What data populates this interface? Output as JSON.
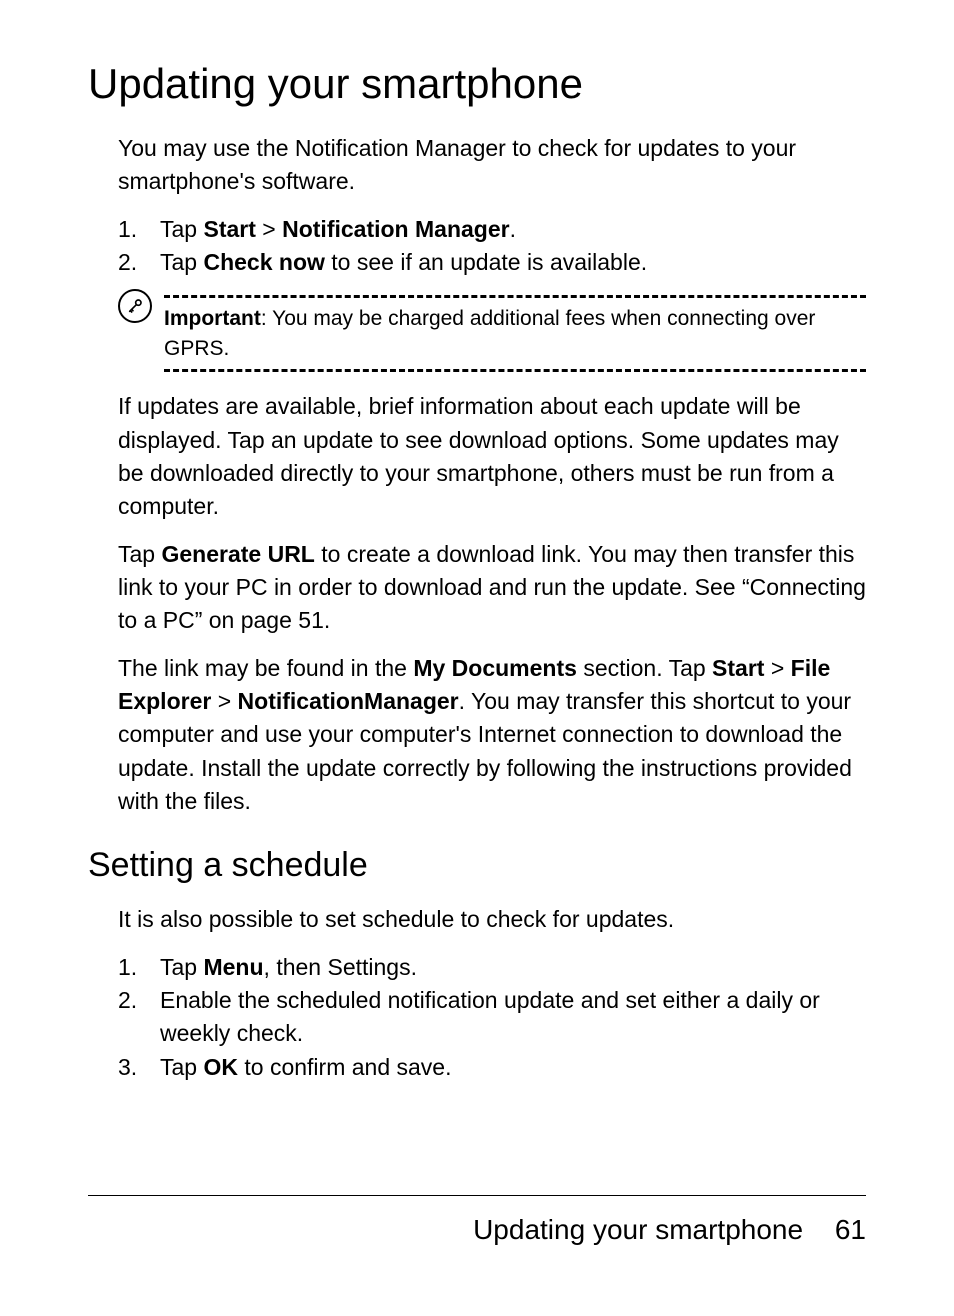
{
  "heading": "Updating your smartphone",
  "intro": "You may use the Notification Manager to check for updates to your smartphone's software.",
  "steps1": {
    "s1a": "Tap ",
    "s1b": "Start",
    "s1c": " > ",
    "s1d": "Notification Manager",
    "s1e": ".",
    "s2a": "Tap ",
    "s2b": "Check now",
    "s2c": " to see if an update is available."
  },
  "note": {
    "label": "Important",
    "text": ": You may be charged additional fees when connecting over GPRS."
  },
  "para2": "If updates are available, brief information about each update will be displayed. Tap an update to see download options. Some updates may be downloaded directly to your smart­phone, others must be run from a computer.",
  "para3": {
    "a": "Tap ",
    "b": "Generate URL",
    "c": " to create a download link. You may then transfer this link to your PC in order to download and run the update. See “Connecting to a PC” on page 51."
  },
  "para4": {
    "a": "The link may be found in the ",
    "b": "My Documents",
    "c": " section. Tap ",
    "d": "Start",
    "e": " > ",
    "f": "File Explorer",
    "g": " > ",
    "h": "NotificationManager",
    "i": ". You may transfer this shortcut to your computer and use your computer's Internet connection to download the update. Install the update cor­rectly by following the instructions provided with the files."
  },
  "subheading": "Setting a schedule",
  "para5": "It is also possible to set schedule to check for updates.",
  "steps2": {
    "s1a": "Tap ",
    "s1b": "Menu",
    "s1c": ", then Settings.",
    "s2": "Enable the scheduled notification update and set either a daily or weekly check.",
    "s3a": "Tap ",
    "s3b": "OK",
    "s3c": " to confirm and save."
  },
  "footer": {
    "title": "Updating your smartphone",
    "page": "61"
  }
}
